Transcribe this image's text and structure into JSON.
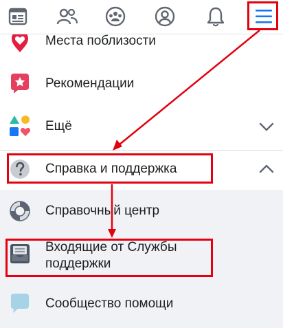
{
  "colors": {
    "accent": "#1877f2",
    "annotation": "#e3000f",
    "icon_gray": "#606770",
    "submenu_bg": "#f0f2f5"
  },
  "topbar": {
    "icons": [
      "news-feed-icon",
      "friends-icon",
      "groups-icon",
      "profile-icon",
      "notifications-bell-icon",
      "menu-hamburger-icon"
    ]
  },
  "menu": {
    "nearby": {
      "label": "Места поблизости",
      "icon": "location-pin-icon"
    },
    "recommendations": {
      "label": "Рекомендации",
      "icon": "star-badge-icon"
    },
    "more": {
      "label": "Ещё",
      "icon": "shapes-icon"
    },
    "help": {
      "label": "Справка и поддержка",
      "icon": "question-mark-icon"
    },
    "help_center": {
      "label": "Справочный центр",
      "icon": "lifebuoy-icon"
    },
    "support_inbox": {
      "label_line1": "Входящие от Службы",
      "label_line2": "поддержки",
      "icon": "inbox-tray-icon"
    },
    "community": {
      "label": "Сообщество помощи",
      "icon": "speech-bubble-icon"
    }
  }
}
